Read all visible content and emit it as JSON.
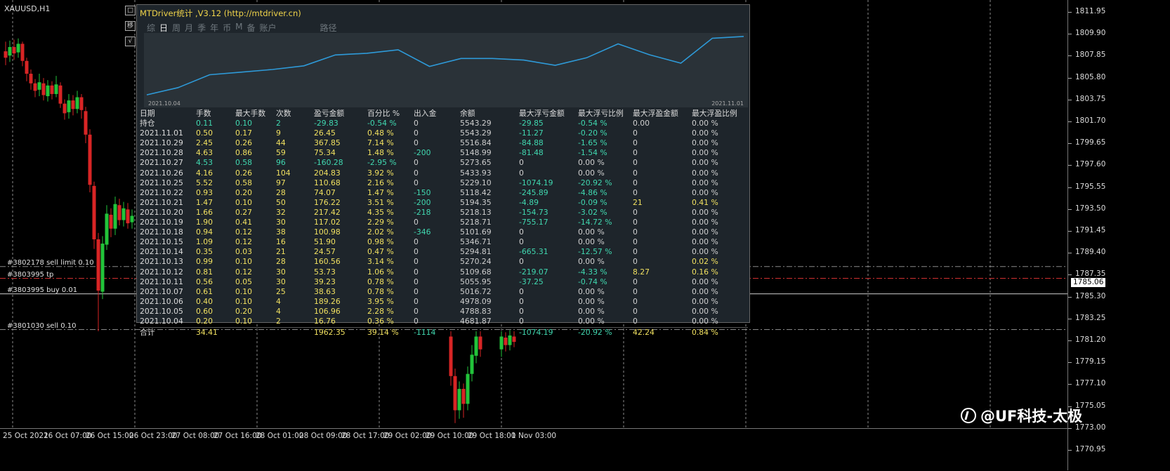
{
  "symbol": "XAUUSD,H1",
  "controls": [
    "□",
    "移",
    "√"
  ],
  "orders": [
    {
      "label": "#3802178 sell limit 0.10",
      "color": "#888888",
      "price": 1788.05
    },
    {
      "label": "#3803995 tp",
      "color": "#d03030",
      "price": 1786.95
    },
    {
      "label": "#3803995 buy 0.01",
      "color": "#cccccc",
      "price": 1785.5
    },
    {
      "label": "#3801030 sell 0.10",
      "color": "#888888",
      "price": 1782.15
    }
  ],
  "price_axis": {
    "ticks": [
      "1811.95",
      "1809.90",
      "1807.85",
      "1805.80",
      "1803.75",
      "1801.70",
      "1799.65",
      "1797.60",
      "1795.55",
      "1793.50",
      "1791.45",
      "1789.40",
      "1787.35",
      "1785.30",
      "1783.25",
      "1781.20",
      "1779.15",
      "1777.10",
      "1775.05",
      "1773.00",
      "1770.95"
    ],
    "current_price": "1785.06"
  },
  "time_axis": [
    "25 Oct 2021",
    "26 Oct 07:00",
    "26 Oct 15:00",
    "26 Oct 23:00",
    "27 Oct 08:00",
    "27 Oct 16:00",
    "28 Oct 01:00",
    "28 Oct 09:00",
    "28 Oct 17:00",
    "29 Oct 02:00",
    "29 Oct 10:00",
    "29 Oct 18:00",
    "1 Nov 03:00"
  ],
  "panel": {
    "title": "MTDriver统计 ,V3.12 (http://mtdriver.cn)",
    "tabs": [
      {
        "label": "综",
        "active": false
      },
      {
        "label": "日",
        "active": true
      },
      {
        "label": "周",
        "active": false
      },
      {
        "label": "月",
        "active": false
      },
      {
        "label": "季",
        "active": false
      },
      {
        "label": "年",
        "active": false
      },
      {
        "label": "币",
        "active": false
      },
      {
        "label": "M",
        "active": false
      },
      {
        "label": "备",
        "active": false
      },
      {
        "label": "账户",
        "active": false
      }
    ],
    "route_label": "路径",
    "equity_start_label": "2021.10.04",
    "equity_end_label": "2021.11.01",
    "columns": [
      "日期",
      "手数",
      "最大手数",
      "次数",
      "盈亏金额",
      "百分比 %",
      "出入金",
      "余额",
      "最大浮亏金额",
      "最大浮亏比例",
      "最大浮盈金额",
      "最大浮盈比例"
    ],
    "rows": [
      [
        "持仓",
        "0.11",
        "0.10",
        "2",
        "-29.83",
        "-0.54 %",
        "0",
        "5543.29",
        "-29.85",
        "-0.54 %",
        "0.00",
        "0.00 %"
      ],
      [
        "2021.11.01",
        "0.50",
        "0.17",
        "9",
        "26.45",
        "0.48 %",
        "0",
        "5543.29",
        "-11.27",
        "-0.20 %",
        "0",
        "0.00 %"
      ],
      [
        "2021.10.29",
        "2.45",
        "0.26",
        "44",
        "367.85",
        "7.14 %",
        "0",
        "5516.84",
        "-84.88",
        "-1.65 %",
        "0",
        "0.00 %"
      ],
      [
        "2021.10.28",
        "4.63",
        "0.86",
        "59",
        "75.34",
        "1.48 %",
        "-200",
        "5148.99",
        "-81.48",
        "-1.54 %",
        "0",
        "0.00 %"
      ],
      [
        "2021.10.27",
        "4.53",
        "0.58",
        "96",
        "-160.28",
        "-2.95 %",
        "0",
        "5273.65",
        "0",
        "0.00 %",
        "0",
        "0.00 %"
      ],
      [
        "2021.10.26",
        "4.16",
        "0.26",
        "104",
        "204.83",
        "3.92 %",
        "0",
        "5433.93",
        "0",
        "0.00 %",
        "0",
        "0.00 %"
      ],
      [
        "2021.10.25",
        "5.52",
        "0.58",
        "97",
        "110.68",
        "2.16 %",
        "0",
        "5229.10",
        "-1074.19",
        "-20.92 %",
        "0",
        "0.00 %"
      ],
      [
        "2021.10.22",
        "0.93",
        "0.20",
        "28",
        "74.07",
        "1.47 %",
        "-150",
        "5118.42",
        "-245.89",
        "-4.86 %",
        "0",
        "0.00 %"
      ],
      [
        "2021.10.21",
        "1.47",
        "0.10",
        "50",
        "176.22",
        "3.51 %",
        "-200",
        "5194.35",
        "-4.89",
        "-0.09 %",
        "21",
        "0.41 %"
      ],
      [
        "2021.10.20",
        "1.66",
        "0.27",
        "32",
        "217.42",
        "4.35 %",
        "-218",
        "5218.13",
        "-154.73",
        "-3.02 %",
        "0",
        "0.00 %"
      ],
      [
        "2021.10.19",
        "1.90",
        "0.41",
        "30",
        "117.02",
        "2.29 %",
        "0",
        "5218.71",
        "-755.17",
        "-14.72 %",
        "0",
        "0.00 %"
      ],
      [
        "2021.10.18",
        "0.94",
        "0.12",
        "38",
        "100.98",
        "2.02 %",
        "-346",
        "5101.69",
        "0",
        "0.00 %",
        "0",
        "0.00 %"
      ],
      [
        "2021.10.15",
        "1.09",
        "0.12",
        "16",
        "51.90",
        "0.98 %",
        "0",
        "5346.71",
        "0",
        "0.00 %",
        "0",
        "0.00 %"
      ],
      [
        "2021.10.14",
        "0.35",
        "0.03",
        "21",
        "24.57",
        "0.47 %",
        "0",
        "5294.81",
        "-665.31",
        "-12.57 %",
        "0",
        "0.00 %"
      ],
      [
        "2021.10.13",
        "0.99",
        "0.10",
        "28",
        "160.56",
        "3.14 %",
        "0",
        "5270.24",
        "0",
        "0.00 %",
        "0",
        "0.02 %"
      ],
      [
        "2021.10.12",
        "0.81",
        "0.12",
        "30",
        "53.73",
        "1.06 %",
        "0",
        "5109.68",
        "-219.07",
        "-4.33 %",
        "8.27",
        "0.16 %"
      ],
      [
        "2021.10.11",
        "0.56",
        "0.05",
        "30",
        "39.23",
        "0.78 %",
        "0",
        "5055.95",
        "-37.25",
        "-0.74 %",
        "0",
        "0.00 %"
      ],
      [
        "2021.10.07",
        "0.61",
        "0.10",
        "25",
        "38.63",
        "0.78 %",
        "0",
        "5016.72",
        "0",
        "0.00 %",
        "0",
        "0.00 %"
      ],
      [
        "2021.10.06",
        "0.40",
        "0.10",
        "4",
        "189.26",
        "3.95 %",
        "0",
        "4978.09",
        "0",
        "0.00 %",
        "0",
        "0.00 %"
      ],
      [
        "2021.10.05",
        "0.60",
        "0.20",
        "4",
        "106.96",
        "2.28 %",
        "0",
        "4788.83",
        "0",
        "0.00 %",
        "0",
        "0.00 %"
      ],
      [
        "2021.10.04",
        "0.20",
        "0.10",
        "2",
        "16.76",
        "0.36 %",
        "0",
        "4681.87",
        "0",
        "0.00 %",
        "0",
        "0.00 %"
      ]
    ],
    "total": [
      "合计",
      "34.41",
      "",
      "",
      "1962.35",
      "39.14 %",
      "-1114",
      "",
      "-1074.19",
      "-20.92 %",
      "42.24",
      "0.84 %"
    ]
  },
  "watermark": "@UF科技-太极"
}
